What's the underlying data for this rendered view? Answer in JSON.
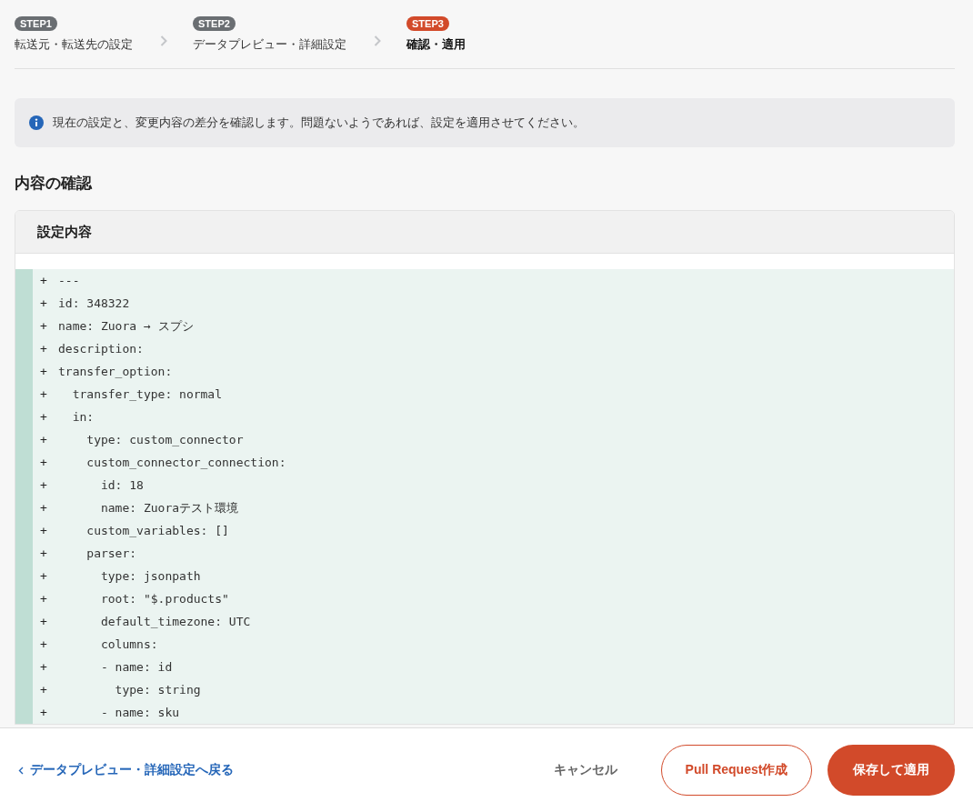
{
  "steps": [
    {
      "badge": "STEP1",
      "label": "転送元・転送先の設定",
      "selected": false
    },
    {
      "badge": "STEP2",
      "label": "データプレビュー・詳細設定",
      "selected": false
    },
    {
      "badge": "STEP3",
      "label": "確認・適用",
      "selected": true
    }
  ],
  "info": {
    "text": "現在の設定と、変更内容の差分を確認します。問題ないようであれば、設定を適用させてください。"
  },
  "section_title": "内容の確認",
  "card": {
    "title": "設定内容",
    "lines": [
      {
        "kind": "added",
        "marker": "+",
        "text": "---"
      },
      {
        "kind": "added",
        "marker": "+",
        "text": "id: 348322"
      },
      {
        "kind": "added",
        "marker": "+",
        "text": "name: Zuora → スプシ"
      },
      {
        "kind": "added",
        "marker": "+",
        "text": "description:"
      },
      {
        "kind": "added",
        "marker": "+",
        "text": "transfer_option:"
      },
      {
        "kind": "added",
        "marker": "+",
        "text": "  transfer_type: normal"
      },
      {
        "kind": "added",
        "marker": "+",
        "text": "  in:"
      },
      {
        "kind": "added",
        "marker": "+",
        "text": "    type: custom_connector"
      },
      {
        "kind": "added",
        "marker": "+",
        "text": "    custom_connector_connection:"
      },
      {
        "kind": "added",
        "marker": "+",
        "text": "      id: 18"
      },
      {
        "kind": "added",
        "marker": "+",
        "text": "      name: Zuoraテスト環境"
      },
      {
        "kind": "added",
        "marker": "+",
        "text": "    custom_variables: []"
      },
      {
        "kind": "added",
        "marker": "+",
        "text": "    parser:"
      },
      {
        "kind": "added",
        "marker": "+",
        "text": "      type: jsonpath"
      },
      {
        "kind": "added",
        "marker": "+",
        "text": "      root: \"$.products\""
      },
      {
        "kind": "added",
        "marker": "+",
        "text": "      default_timezone: UTC"
      },
      {
        "kind": "added",
        "marker": "+",
        "text": "      columns:"
      },
      {
        "kind": "added",
        "marker": "+",
        "text": "      - name: id"
      },
      {
        "kind": "added",
        "marker": "+",
        "text": "        type: string"
      },
      {
        "kind": "added",
        "marker": "+",
        "text": "      - name: sku"
      }
    ]
  },
  "footer": {
    "back_link": "データプレビュー・詳細設定へ戻る",
    "cancel": "キャンセル",
    "pull_request": "Pull Request作成",
    "save": "保存して適用"
  }
}
